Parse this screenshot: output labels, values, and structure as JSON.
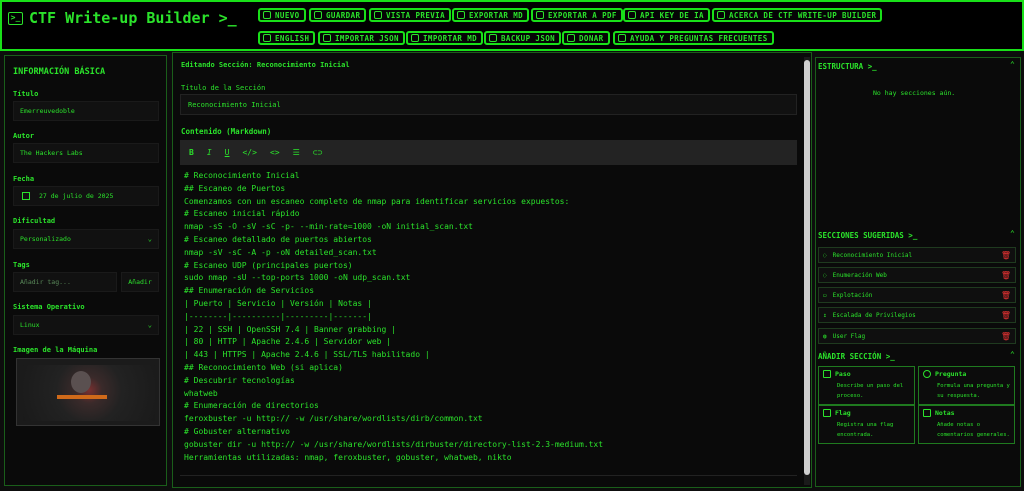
{
  "app": {
    "title": "CTF Write-up Builder >_"
  },
  "toolbar": {
    "row1": [
      "NUEVO",
      "GUARDAR",
      "VISTA PREVIA",
      "EXPORTAR MD",
      "EXPORTAR A PDF",
      "API KEY DE IA",
      "ACERCA DE CTF WRITE-UP BUILDER"
    ],
    "row2": [
      "ENGLISH",
      "IMPORTAR JSON",
      "IMPORTAR MD",
      "BACKUP JSON",
      "DONAR",
      "AYUDA Y PREGUNTAS FRECUENTES"
    ]
  },
  "info": {
    "heading": "INFORMACIÓN BÁSICA",
    "title_label": "Título",
    "title_value": "Emerreuvedoble",
    "author_label": "Autor",
    "author_value": "The Hackers Labs",
    "date_label": "Fecha",
    "date_value": "27 de julio de 2025",
    "difficulty_label": "Dificultad",
    "difficulty_value": "Personalizado",
    "tags_label": "Tags",
    "tags_placeholder": "Añadir tag...",
    "tags_add": "Añadir",
    "os_label": "Sistema Operativo",
    "os_value": "Linux",
    "image_label": "Imagen de la Máquina"
  },
  "editor": {
    "heading": "Editando Sección: Reconocimiento Inicial",
    "section_title_label": "Título de la Sección",
    "section_title_value": "Reconocimiento Inicial",
    "content_label": "Contenido (Markdown)",
    "lines": [
      "# Reconocimiento Inicial",
      "## Escaneo de Puertos",
      "Comenzamos con un escaneo completo de nmap para identificar servicios expuestos:",
      "# Escaneo inicial rápido",
      "nmap -sS -O -sV -sC -p- --min-rate=1000 -oN initial_scan.txt",
      "# Escaneo detallado de puertos abiertos",
      "nmap -sV -sC -A -p -oN detailed_scan.txt",
      "# Escaneo UDP (principales puertos)",
      "sudo nmap -sU --top-ports 1000 -oN udp_scan.txt",
      "## Enumeración de Servicios",
      "| Puerto | Servicio | Versión | Notas |",
      "|--------|----------|---------|-------|",
      "| 22 | SSH | OpenSSH 7.4 | Banner grabbing |",
      "| 80 | HTTP | Apache 2.4.6 | Servidor web |",
      "| 443 | HTTPS | Apache 2.4.6 | SSL/TLS habilitado |",
      "## Reconocimiento Web (si aplica)",
      "# Descubrir tecnologías",
      "whatweb",
      "# Enumeración de directorios",
      "feroxbuster -u http:// -w /usr/share/wordlists/dirb/common.txt",
      "# Gobuster alternativo",
      "gobuster dir -u http:// -w /usr/share/wordlists/dirbuster/directory-list-2.3-medium.txt",
      "Herramientas utilizadas: nmap, feroxbuster, gobuster, whatweb, nikto"
    ]
  },
  "structure": {
    "heading": "ESTRUCTURA >_",
    "empty": "No hay secciones aún."
  },
  "suggested": {
    "heading": "SECCIONES SUGERIDAS >_",
    "items": [
      "Reconocimiento Inicial",
      "Enumeración Web",
      "Explotación",
      "Escalada de Privilegios",
      "User Flag"
    ]
  },
  "add": {
    "heading": "AÑADIR SECCIÓN >_",
    "cards": [
      {
        "title": "Paso",
        "desc1": "Describe un paso del",
        "desc2": "proceso."
      },
      {
        "title": "Pregunta",
        "desc1": "Formula una pregunta y",
        "desc2": "su respuesta."
      },
      {
        "title": "Flag",
        "desc1": "Registra una flag",
        "desc2": "encontrada."
      },
      {
        "title": "Notas",
        "desc1": "Añade notas o",
        "desc2": "comentarios generales."
      }
    ]
  },
  "colors": {
    "accent": "#2be32b",
    "delete": "#e33333",
    "bg": "#0d0d0d"
  }
}
